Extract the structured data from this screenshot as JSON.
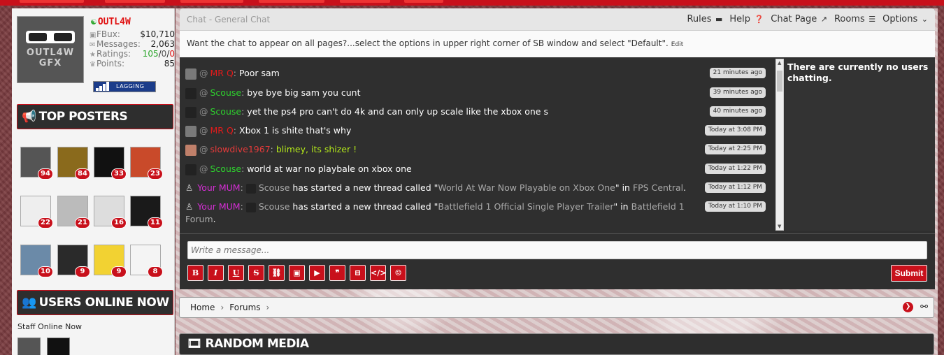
{
  "profile": {
    "username": "OUTL4W",
    "avatar_text_1": "OUTL4W",
    "avatar_text_2": "GFX",
    "stats": [
      {
        "icon": "money-icon",
        "label": "FBux:",
        "value": "$10,710"
      },
      {
        "icon": "messages-icon",
        "label": "Messages:",
        "value": "2,063"
      },
      {
        "icon": "star-icon",
        "label": "Ratings:",
        "value": ""
      },
      {
        "icon": "trophy-icon",
        "label": "Points:",
        "value": "85"
      }
    ],
    "ratings": {
      "positive": "105",
      "neutral": "0",
      "negative": "0"
    },
    "status": "LAGGING"
  },
  "top_posters": {
    "title": "TOP POSTERS",
    "posters": [
      {
        "count": "94"
      },
      {
        "count": "84"
      },
      {
        "count": "33"
      },
      {
        "count": "23"
      },
      {
        "count": "22"
      },
      {
        "count": "21"
      },
      {
        "count": "16"
      },
      {
        "count": "11"
      },
      {
        "count": "10"
      },
      {
        "count": "9"
      },
      {
        "count": "9"
      },
      {
        "count": "8"
      }
    ]
  },
  "users_online": {
    "title": "USERS ONLINE NOW",
    "staff_label": "Staff Online Now"
  },
  "chat": {
    "title": "Chat - General Chat",
    "menu": [
      "Rules",
      "Help",
      "Chat Page",
      "Rooms",
      "Options"
    ],
    "notice": "Want the chat to appear on all pages?...select the options in upper right corner of SB window and select \"Default\".",
    "notice_edit": "Edit",
    "messages": [
      {
        "user": "MR Q",
        "text": "Poor sam",
        "time": "21 minutes ago"
      },
      {
        "user": "Scouse",
        "text": "bye bye big sam you cunt",
        "time": "39 minutes ago"
      },
      {
        "user": "Scouse",
        "text": "yet the ps4 pro can't do 4k and can only up scale like the xbox one s",
        "time": "40 minutes ago"
      },
      {
        "user": "MR Q",
        "text": "Xbox 1 is shite that's why",
        "time": "Today at 3:08 PM"
      },
      {
        "user": "slowdive1967",
        "text": "blimey, its shizer !",
        "time": "Today at 2:25 PM"
      },
      {
        "user": "Scouse",
        "text": "world at war no playbale on xbox one",
        "time": "Today at 1:22 PM"
      },
      {
        "user": "Your MUM",
        "thread_user": "Scouse",
        "mid": " has started a new thread called \"",
        "thread": "World At War Now Playable on Xbox One",
        "close": "\" in ",
        "forum": "FPS Central",
        "end": ".",
        "time": "Today at 1:12 PM"
      },
      {
        "user": "Your MUM",
        "thread_user": "Scouse",
        "mid": " has started a new thread called \"",
        "thread": "Battlefield 1 Official Single Player Trailer",
        "close": "\" in ",
        "forum": "Battlefield 1",
        "wrap": "Forum",
        "end": ".",
        "time": "Today at 1:10 PM"
      }
    ],
    "online_text": "There are currently no users chatting.",
    "input_placeholder": "Write a message...",
    "tools": [
      "B",
      "I",
      "U",
      "S",
      "link-icon",
      "image-icon",
      "media-icon",
      "quote-icon",
      "spoiler-icon",
      "code-icon",
      "smilie-icon"
    ],
    "submit": "Submit"
  },
  "breadcrumb": [
    "Home",
    "Forums"
  ],
  "random_media": {
    "title": "RANDOM MEDIA"
  },
  "colors": {
    "accent": "#c8101b",
    "dark": "#2e2e2e"
  }
}
